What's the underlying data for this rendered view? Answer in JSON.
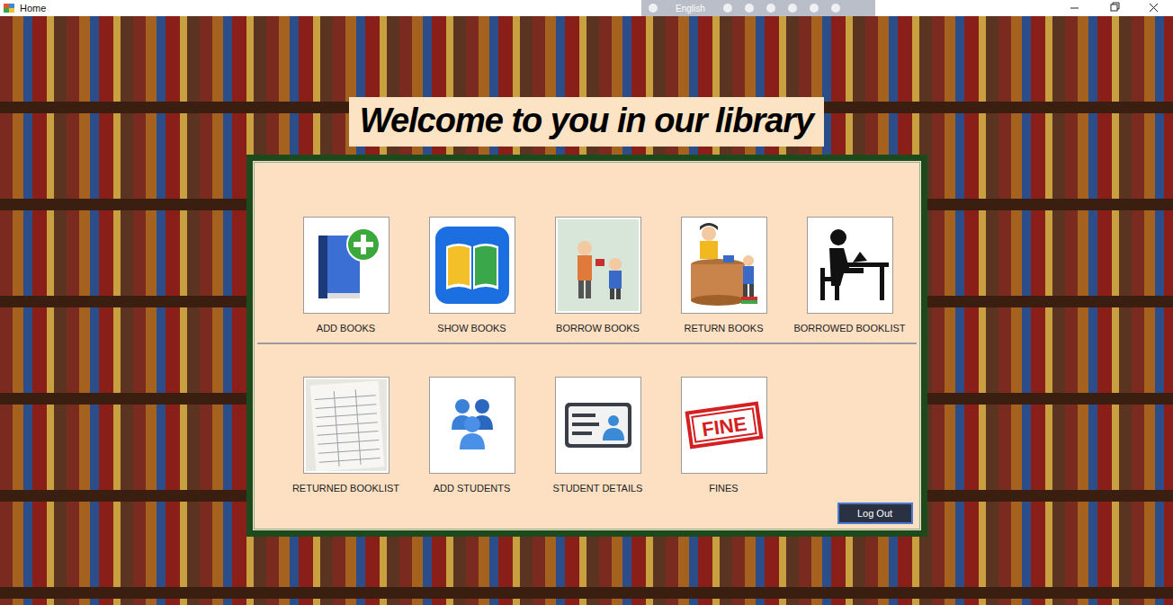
{
  "window": {
    "title": "Home"
  },
  "language_bar": {
    "label": "English"
  },
  "banner": {
    "text": "Welcome to you in our library"
  },
  "menu_rows": [
    [
      {
        "label": "ADD BOOKS",
        "kind": "add-book"
      },
      {
        "label": "SHOW BOOKS",
        "kind": "show-books"
      },
      {
        "label": "BORROW BOOKS",
        "kind": "borrow"
      },
      {
        "label": "RETURN BOOKS",
        "kind": "return"
      },
      {
        "label": "BORROWED BOOKLIST",
        "kind": "reader"
      }
    ],
    [
      {
        "label": "RETURNED BOOKLIST",
        "kind": "ledger"
      },
      {
        "label": "ADD STUDENTS",
        "kind": "students"
      },
      {
        "label": "STUDENT DETAILS",
        "kind": "id-card"
      },
      {
        "label": "FINES",
        "kind": "fine",
        "icon_text": "FINE"
      }
    ]
  ],
  "logout": {
    "label": "Log Out"
  }
}
